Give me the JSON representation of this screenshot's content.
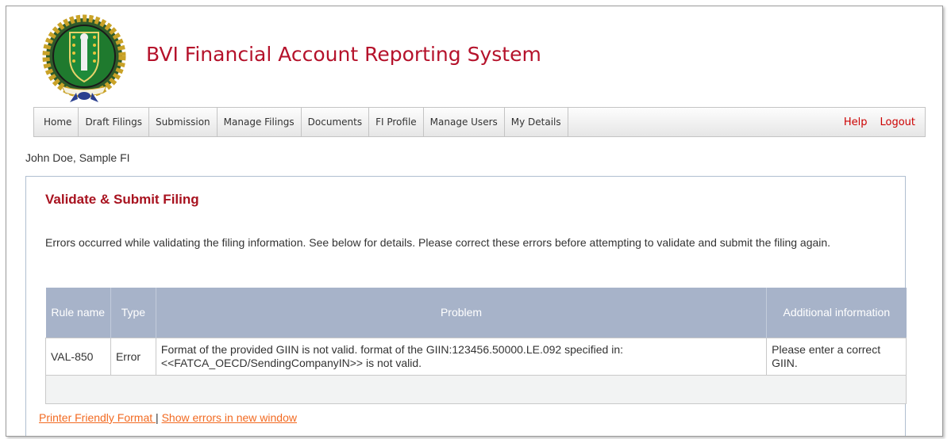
{
  "header": {
    "title": "BVI Financial Account Reporting System"
  },
  "nav": {
    "items": [
      {
        "label": "Home"
      },
      {
        "label": "Draft Filings"
      },
      {
        "label": "Submission"
      },
      {
        "label": "Manage Filings"
      },
      {
        "label": "Documents"
      },
      {
        "label": "FI Profile"
      },
      {
        "label": "Manage Users"
      },
      {
        "label": "My Details"
      }
    ],
    "help_label": "Help",
    "logout_label": "Logout"
  },
  "user": {
    "name_line": "John Doe, Sample FI"
  },
  "main": {
    "title": "Validate & Submit Filing",
    "message": "Errors occurred while validating the filing information. See below for details. Please correct these errors before attempting to validate and submit the filing again.",
    "table": {
      "headers": {
        "rule_name": "Rule name",
        "type": "Type",
        "problem": "Problem",
        "additional": "Additional information"
      },
      "rows": [
        {
          "rule_name": "VAL-850",
          "type": "Error",
          "problem": "Format of the provided GIIN is not valid. format of the GIIN:123456.50000.LE.092 specified in: <<FATCA_OECD/SendingCompanyIN>> is not valid.",
          "additional": "Please enter a correct GIIN."
        }
      ]
    },
    "links": {
      "printer_friendly": "Printer Friendly Format ",
      "separator": "|",
      "show_errors": "Show errors in new window"
    }
  },
  "colors": {
    "title_red": "#b5122b",
    "header_blue_gray": "#a7b3c9",
    "link_orange": "#f26a21"
  }
}
